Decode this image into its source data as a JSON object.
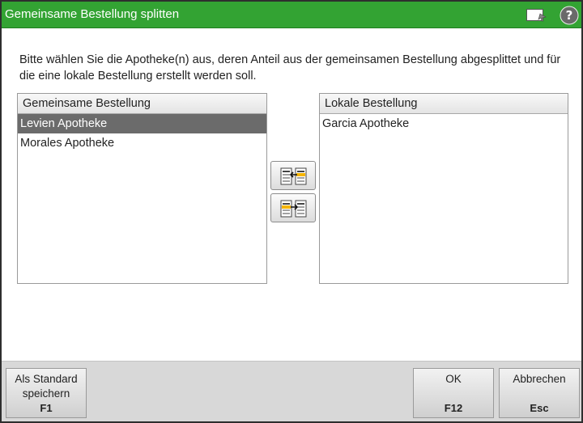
{
  "window": {
    "title": "Gemeinsame Bestellung splitten"
  },
  "instruction": "Bitte wählen Sie die Apotheke(n) aus, deren Anteil aus der gemeinsamen Bestellung abgesplittet und für die eine lokale Bestellung erstellt werden soll.",
  "left_list": {
    "header": "Gemeinsame Bestellung",
    "items": [
      "Levien Apotheke",
      "Morales Apotheke"
    ],
    "selected_index": 0
  },
  "right_list": {
    "header": "Lokale Bestellung",
    "items": [
      "Garcia Apotheke"
    ]
  },
  "footer": {
    "standard": {
      "label": "Als Standard speichern",
      "key": "F1"
    },
    "ok": {
      "label": "OK",
      "key": "F12"
    },
    "cancel": {
      "label": "Abbrechen",
      "key": "Esc"
    }
  },
  "colors": {
    "titlebar": "#33a333",
    "selection": "#6b6b6b"
  }
}
